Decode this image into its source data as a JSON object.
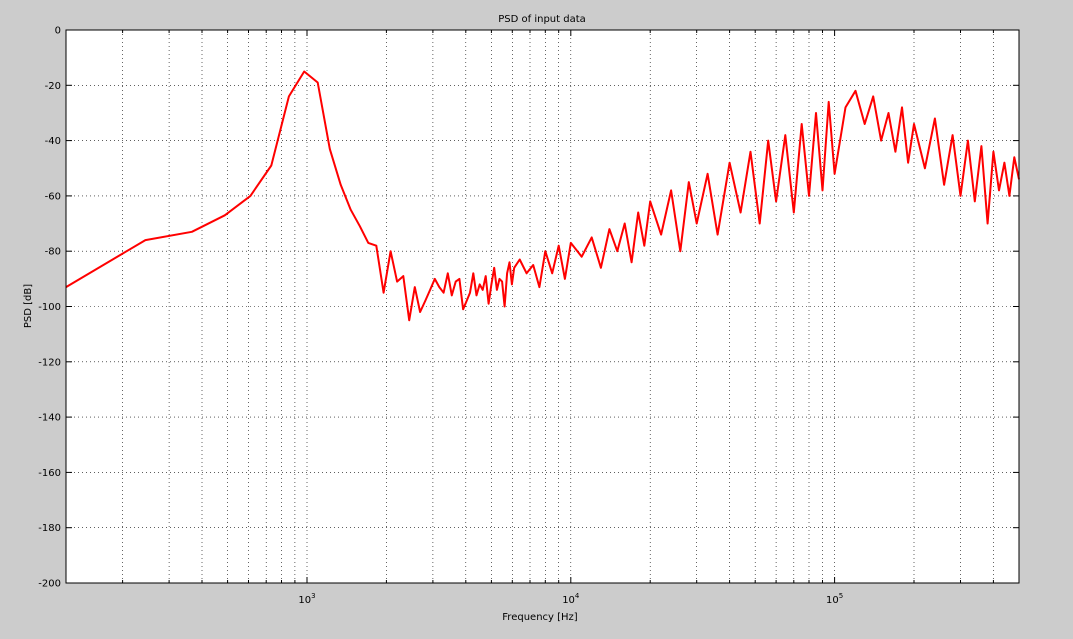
{
  "chart_data": {
    "type": "line",
    "title": "PSD of input data",
    "xlabel": "Frequency [Hz]",
    "ylabel": "PSD [dB]",
    "xscale": "log",
    "xlim": [
      122,
      500000
    ],
    "ylim": [
      -200,
      0
    ],
    "yticks": [
      0,
      -20,
      -40,
      -60,
      -80,
      -100,
      -120,
      -140,
      -160,
      -180,
      -200
    ],
    "xticks_major": [
      {
        "base": "10",
        "exp": "3",
        "value": 1000
      },
      {
        "base": "10",
        "exp": "4",
        "value": 10000
      },
      {
        "base": "10",
        "exp": "5",
        "value": 100000
      }
    ],
    "grid": true,
    "background": "#cccccc",
    "axes_color": "#ffffff",
    "series": [
      {
        "color": "#ff0000",
        "x": [
          122,
          244,
          366,
          488,
          610,
          732,
          854,
          976,
          1098,
          1220,
          1342,
          1464,
          1586,
          1708,
          1830,
          1952,
          2074,
          2196,
          2318,
          2440,
          2562,
          2684,
          2806,
          2928,
          3050,
          3172,
          3294,
          3416,
          3538,
          3660,
          3782,
          3904,
          4026,
          4148,
          4270,
          4392,
          4514,
          4636,
          4758,
          4880,
          5002,
          5124,
          5246,
          5368,
          5490,
          5612,
          5734,
          5856,
          5978,
          6100,
          6400,
          6800,
          7200,
          7600,
          8000,
          8500,
          9000,
          9500,
          10000,
          11000,
          12000,
          13000,
          14000,
          15000,
          16000,
          17000,
          18000,
          19000,
          20000,
          22000,
          24000,
          26000,
          28000,
          30000,
          33000,
          36000,
          40000,
          44000,
          48000,
          52000,
          56000,
          60000,
          65000,
          70000,
          75000,
          80000,
          85000,
          90000,
          95000,
          100000,
          110000,
          120000,
          130000,
          140000,
          150000,
          160000,
          170000,
          180000,
          190000,
          200000,
          220000,
          240000,
          260000,
          280000,
          300000,
          320000,
          340000,
          360000,
          380000,
          400000,
          420000,
          440000,
          460000,
          480000,
          500000
        ],
        "y": [
          -93,
          -76,
          -73,
          -67,
          -60,
          -49,
          -24,
          -15,
          -19,
          -43,
          -56,
          -65,
          -71,
          -77,
          -78,
          -95,
          -80,
          -91,
          -89,
          -105,
          -93,
          -102,
          -98,
          -94,
          -90,
          -93,
          -95,
          -88,
          -96,
          -91,
          -90,
          -101,
          -98,
          -95,
          -88,
          -96,
          -92,
          -94,
          -89,
          -99,
          -92,
          -86,
          -94,
          -90,
          -91,
          -100,
          -88,
          -84,
          -92,
          -86,
          -83,
          -88,
          -85,
          -93,
          -80,
          -88,
          -78,
          -90,
          -77,
          -82,
          -75,
          -86,
          -72,
          -80,
          -70,
          -84,
          -66,
          -78,
          -62,
          -74,
          -58,
          -80,
          -55,
          -70,
          -52,
          -74,
          -48,
          -66,
          -44,
          -70,
          -40,
          -62,
          -38,
          -66,
          -34,
          -60,
          -30,
          -58,
          -26,
          -52,
          -28,
          -22,
          -34,
          -24,
          -40,
          -30,
          -44,
          -28,
          -48,
          -34,
          -50,
          -32,
          -56,
          -38,
          -60,
          -40,
          -62,
          -42,
          -70,
          -44,
          -58,
          -48,
          -60,
          -46,
          -54
        ]
      }
    ]
  }
}
